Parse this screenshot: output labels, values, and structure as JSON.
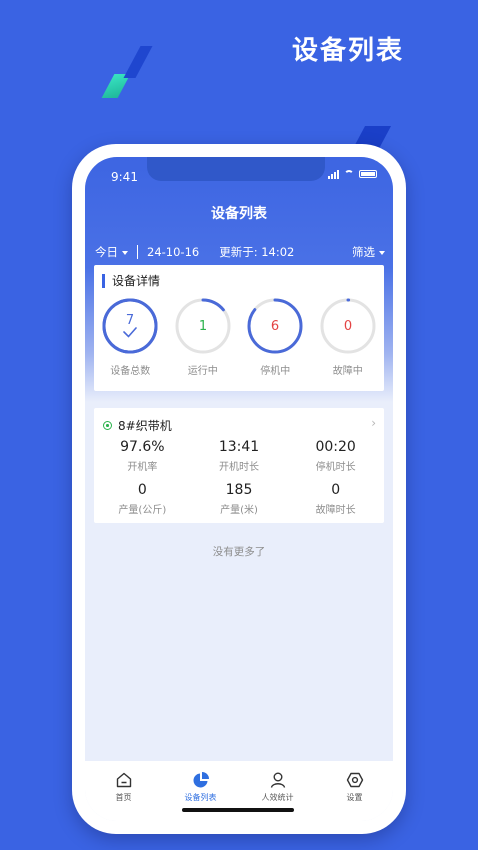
{
  "promo": {
    "title": "设备列表"
  },
  "status_bar": {
    "time": "9:41"
  },
  "app": {
    "title": "设备列表"
  },
  "filter": {
    "period": "今日",
    "date": "24-10-16",
    "updated": "更新于: 14:02",
    "filter_label": "筛选"
  },
  "detail": {
    "title": "设备详情",
    "gauges": [
      {
        "value": "7",
        "label": "设备总数",
        "fraction": 1.0,
        "color": "#4a6ad8",
        "track": "#4a6ad8"
      },
      {
        "value": "1",
        "label": "运行中",
        "fraction": 0.143,
        "color": "#4a6ad8",
        "track": "#e3e3e3",
        "num_color": "#2bb24c"
      },
      {
        "value": "6",
        "label": "停机中",
        "fraction": 0.857,
        "color": "#4a6ad8",
        "track": "#e3e3e3",
        "num_color": "#e34343"
      },
      {
        "value": "0",
        "label": "故障中",
        "fraction": 0.0,
        "color": "#4a6ad8",
        "track": "#e3e3e3",
        "num_color": "#e34343"
      }
    ]
  },
  "machine": {
    "name": "8#织带机",
    "stats": [
      {
        "value": "97.6%",
        "label": "开机率"
      },
      {
        "value": "13:41",
        "label": "开机时长"
      },
      {
        "value": "00:20",
        "label": "停机时长"
      },
      {
        "value": "0",
        "label": "产量(公斤)"
      },
      {
        "value": "185",
        "label": "产量(米)"
      },
      {
        "value": "0",
        "label": "故障时长"
      }
    ]
  },
  "list": {
    "end_text": "没有更多了"
  },
  "tabs": [
    {
      "label": "首页",
      "icon": "home-icon"
    },
    {
      "label": "设备列表",
      "icon": "pie-chart-icon",
      "active": true
    },
    {
      "label": "人效统计",
      "icon": "person-icon"
    },
    {
      "label": "设置",
      "icon": "gear-icon"
    }
  ],
  "colors": {
    "brand": "#3a63e3",
    "active_tab": "#2f6fe0"
  }
}
